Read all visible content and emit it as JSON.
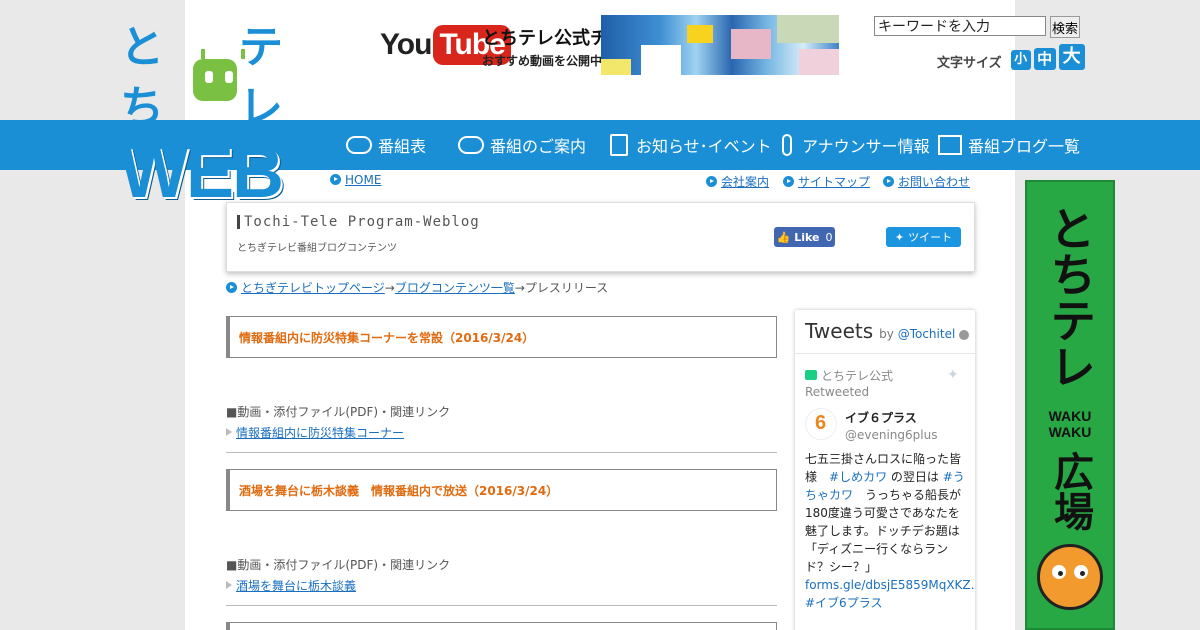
{
  "logo": {
    "line1_a": "とち",
    "line1_b": "テレ",
    "line2": "WEB"
  },
  "youtube": {
    "you": "You",
    "tube": "Tube",
    "title": "とちテレ公式チャンネル",
    "subtitle": "おすすめ動画を公開中!"
  },
  "search": {
    "placeholder": "キーワードを入力",
    "button": "検索"
  },
  "font_size": {
    "label": "文字サイズ",
    "small": "小",
    "medium": "中",
    "large": "大"
  },
  "nav": [
    {
      "label": "番組表",
      "icon": "speech-bubble-icon"
    },
    {
      "label": "番組のご案内",
      "icon": "speech-bubble-icon"
    },
    {
      "label": "お知らせ･イベント",
      "icon": "document-icon"
    },
    {
      "label": "アナウンサー情報",
      "icon": "microphone-icon"
    },
    {
      "label": "番組ブログ一覧",
      "icon": "screen-icon"
    }
  ],
  "toplinks": {
    "home": "HOME",
    "company": "会社案内",
    "sitemap": "サイトマップ",
    "contact": "お問い合わせ"
  },
  "blog": {
    "title": "Tochi-Tele Program-Weblog",
    "subtitle": "とちぎテレビ番組ブログコンテンツ",
    "like": "Like",
    "like_count": "0",
    "tweet": "ツイート"
  },
  "breadcrumb": {
    "top": "とちぎテレビトップページ",
    "sep1": "→",
    "list": "ブログコンテンツ一覧",
    "sep2": "→",
    "current": "プレスリリース"
  },
  "articles": [
    {
      "title": "情報番組内に防災特集コーナーを常設（2016/3/24）",
      "attach_label": "■動画・添付ファイル(PDF)・関連リンク",
      "link": "情報番組内に防災特集コーナー"
    },
    {
      "title": "酒場を舞台に栃木談義　情報番組内で放送（2016/3/24）",
      "attach_label": "■動画・添付ファイル(PDF)・関連リンク",
      "link": "酒場を舞台に栃木談義"
    }
  ],
  "tweets": {
    "header": "Tweets",
    "by": "by",
    "account": "@Tochitel",
    "retweeter": "とちテレ公式",
    "retweeted": "Retweeted",
    "name": "イブ６プラス",
    "handle": "@evening6plus",
    "body_1": "七五三掛さんロスに陥った皆様　",
    "tag1": "#しめカワ",
    "body_2": " の翌日は ",
    "tag2": "#うちゃカワ",
    "body_3": "　うっちゃる船長が180度違う可愛さであなたを魅了します。ドッチデお題は「ディズニー行くならランド？シー？」",
    "link": "forms.gle/dbsjE5859MqXKZ…",
    "tag3": "#イブ6プラス"
  },
  "banner": {
    "line1": "とちテレ",
    "line2a": "WAKU",
    "line2b": "WAKU",
    "line3": "広場"
  },
  "colors": {
    "brand_blue": "#1a8fd6",
    "orange_title": "#e06b10",
    "banner_green": "#28a745"
  }
}
